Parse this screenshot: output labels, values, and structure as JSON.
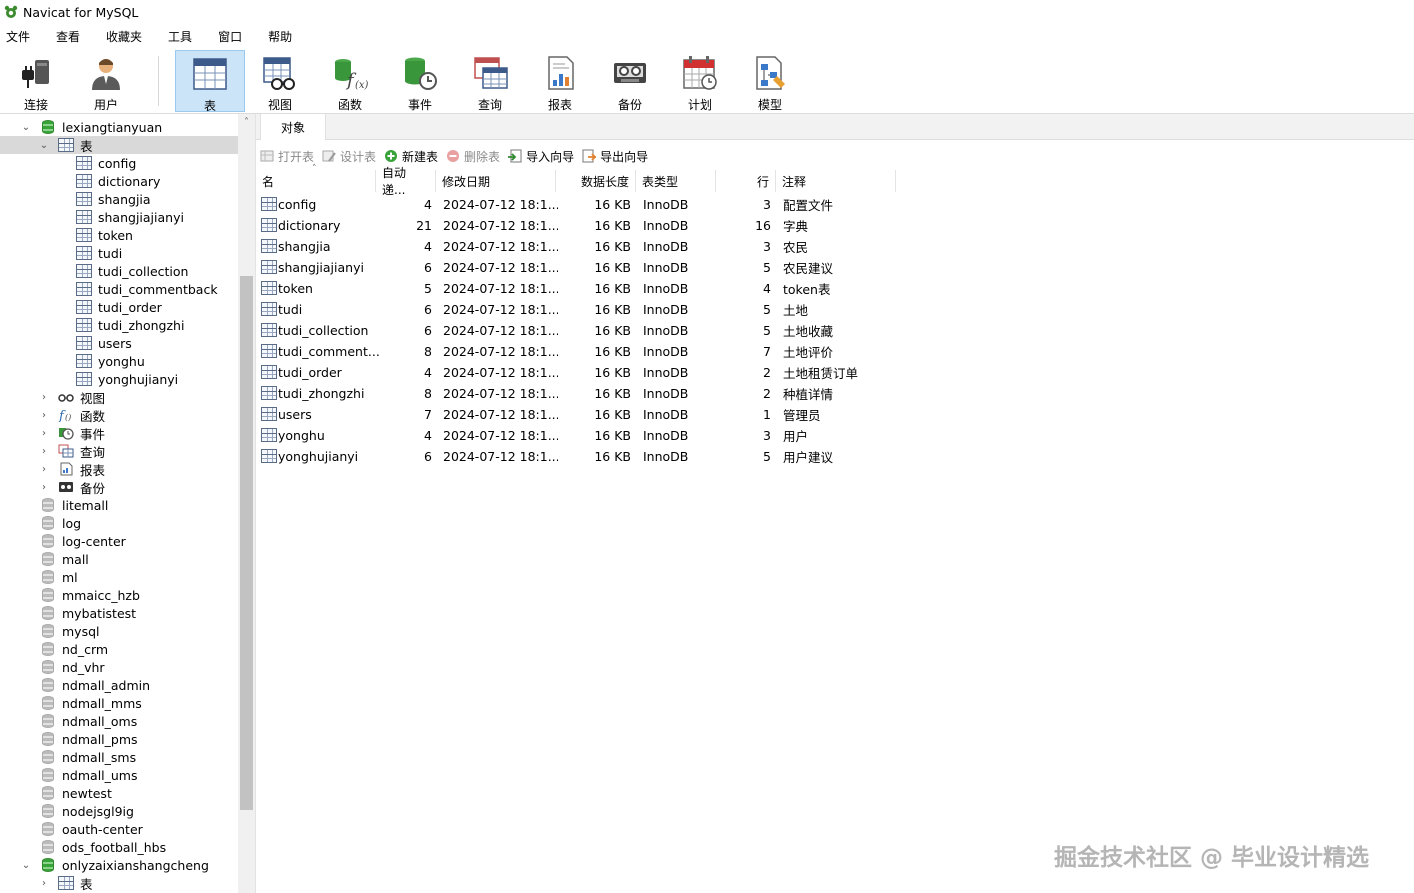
{
  "window": {
    "title": "Navicat for MySQL"
  },
  "menu": [
    "文件",
    "查看",
    "收藏夹",
    "工具",
    "窗口",
    "帮助"
  ],
  "toolbar": {
    "buttons": [
      {
        "label": "连接",
        "icon": "plug-icon"
      },
      {
        "label": "用户",
        "icon": "user-icon"
      },
      {
        "label": "表",
        "icon": "table-icon",
        "active": true
      },
      {
        "label": "视图",
        "icon": "view-icon"
      },
      {
        "label": "函数",
        "icon": "function-icon"
      },
      {
        "label": "事件",
        "icon": "event-icon"
      },
      {
        "label": "查询",
        "icon": "query-icon"
      },
      {
        "label": "报表",
        "icon": "report-icon"
      },
      {
        "label": "备份",
        "icon": "backup-icon"
      },
      {
        "label": "计划",
        "icon": "schedule-icon"
      },
      {
        "label": "模型",
        "icon": "model-icon"
      }
    ]
  },
  "sidebar": {
    "active_db": "lexiangtianyuan",
    "tables_node": "表",
    "tables": [
      "config",
      "dictionary",
      "shangjia",
      "shangjiajianyi",
      "token",
      "tudi",
      "tudi_collection",
      "tudi_commentback",
      "tudi_order",
      "tudi_zhongzhi",
      "users",
      "yonghu",
      "yonghujianyi"
    ],
    "other_nodes": [
      "视图",
      "函数",
      "事件",
      "查询",
      "报表",
      "备份"
    ],
    "databases": [
      "litemall",
      "log",
      "log-center",
      "mall",
      "ml",
      "mmaicc_hzb",
      "mybatistest",
      "mysql",
      "nd_crm",
      "nd_vhr",
      "ndmall_admin",
      "ndmall_mms",
      "ndmall_oms",
      "ndmall_pms",
      "ndmall_sms",
      "ndmall_ums",
      "newtest",
      "nodejsgl9ig",
      "oauth-center",
      "ods_football_hbs"
    ],
    "last_db": "onlyzaixianshangcheng",
    "last_db_child": "表"
  },
  "content": {
    "tab_label": "对象",
    "actions": {
      "open": "打开表",
      "design": "设计表",
      "new": "新建表",
      "delete": "删除表",
      "import": "导入向导",
      "export": "导出向导"
    },
    "columns": {
      "name": "名",
      "auto_inc": "自动递...",
      "modified": "修改日期",
      "data_length": "数据长度",
      "table_type": "表类型",
      "rows": "行",
      "comment": "注释"
    },
    "rows": [
      {
        "name": "config",
        "auto_inc": "4",
        "modified": "2024-07-12 18:1...",
        "data_length": "16 KB",
        "table_type": "InnoDB",
        "rows": "3",
        "comment": "配置文件"
      },
      {
        "name": "dictionary",
        "auto_inc": "21",
        "modified": "2024-07-12 18:1...",
        "data_length": "16 KB",
        "table_type": "InnoDB",
        "rows": "16",
        "comment": "字典"
      },
      {
        "name": "shangjia",
        "auto_inc": "4",
        "modified": "2024-07-12 18:1...",
        "data_length": "16 KB",
        "table_type": "InnoDB",
        "rows": "3",
        "comment": "农民"
      },
      {
        "name": "shangjiajianyi",
        "auto_inc": "6",
        "modified": "2024-07-12 18:1...",
        "data_length": "16 KB",
        "table_type": "InnoDB",
        "rows": "5",
        "comment": "农民建议"
      },
      {
        "name": "token",
        "auto_inc": "5",
        "modified": "2024-07-12 18:1...",
        "data_length": "16 KB",
        "table_type": "InnoDB",
        "rows": "4",
        "comment": "token表"
      },
      {
        "name": "tudi",
        "auto_inc": "6",
        "modified": "2024-07-12 18:1...",
        "data_length": "16 KB",
        "table_type": "InnoDB",
        "rows": "5",
        "comment": "土地"
      },
      {
        "name": "tudi_collection",
        "auto_inc": "6",
        "modified": "2024-07-12 18:1...",
        "data_length": "16 KB",
        "table_type": "InnoDB",
        "rows": "5",
        "comment": "土地收藏"
      },
      {
        "name": "tudi_comment...",
        "auto_inc": "8",
        "modified": "2024-07-12 18:1...",
        "data_length": "16 KB",
        "table_type": "InnoDB",
        "rows": "7",
        "comment": "土地评价"
      },
      {
        "name": "tudi_order",
        "auto_inc": "4",
        "modified": "2024-07-12 18:1...",
        "data_length": "16 KB",
        "table_type": "InnoDB",
        "rows": "2",
        "comment": "土地租赁订单"
      },
      {
        "name": "tudi_zhongzhi",
        "auto_inc": "8",
        "modified": "2024-07-12 18:1...",
        "data_length": "16 KB",
        "table_type": "InnoDB",
        "rows": "2",
        "comment": "种植详情"
      },
      {
        "name": "users",
        "auto_inc": "7",
        "modified": "2024-07-12 18:1...",
        "data_length": "16 KB",
        "table_type": "InnoDB",
        "rows": "1",
        "comment": "管理员"
      },
      {
        "name": "yonghu",
        "auto_inc": "4",
        "modified": "2024-07-12 18:1...",
        "data_length": "16 KB",
        "table_type": "InnoDB",
        "rows": "3",
        "comment": "用户"
      },
      {
        "name": "yonghujianyi",
        "auto_inc": "6",
        "modified": "2024-07-12 18:1...",
        "data_length": "16 KB",
        "table_type": "InnoDB",
        "rows": "5",
        "comment": "用户建议"
      }
    ]
  },
  "watermark": "掘金技术社区 @ 毕业设计精选"
}
